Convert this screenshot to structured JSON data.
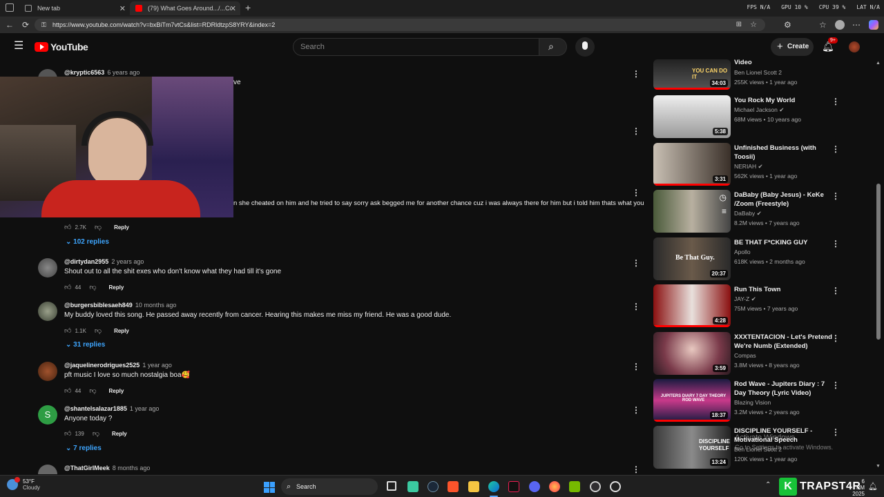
{
  "browser": {
    "tabs": [
      {
        "label": "New tab",
        "active": false
      },
      {
        "label": "(79) What Goes Around.../...Com",
        "active": true
      }
    ],
    "perf": {
      "fps": "FPS N/A",
      "gpu": "GPU 10 %",
      "cpu": "CPU 39 %",
      "lat": "LAT N/A"
    },
    "url": "https://www.youtube.com/watch?v=bxBiTm7vtCs&list=RDRldtzpS8YRY&index=2"
  },
  "header": {
    "logo_text": "YouTube",
    "search_placeholder": "Search",
    "create_label": "Create",
    "notifications_badge": "9+"
  },
  "comments": [
    {
      "handle": "@kryptic6563",
      "age": "6 years ago",
      "text": "ve",
      "likes": "",
      "reply": "",
      "replies": ""
    },
    {
      "handle": "",
      "age": "",
      "text": "n she cheated on him and he tried to say sorry ask begged me for another chance cuz i was always there for him but i told him thats what you",
      "likes": "2.7K",
      "reply": "Reply",
      "replies": "102 replies"
    },
    {
      "handle": "@dirtydan2955",
      "age": "2 years ago",
      "text": "Shout out to all the shit exes who don't know what they had till it's gone",
      "likes": "44",
      "reply": "Reply",
      "replies": ""
    },
    {
      "handle": "@burgersbiblesaeh849",
      "age": "10 months ago",
      "text": "My buddy loved this song. He passed away recently from cancer. Hearing this makes me miss my friend. He was a good dude.",
      "likes": "1.1K",
      "reply": "Reply",
      "replies": "31 replies"
    },
    {
      "handle": "@jaquelinerodrigues2525",
      "age": "1 year ago",
      "text": "pft music I love so much nostalgia boa🥰",
      "likes": "44",
      "reply": "Reply",
      "replies": ""
    },
    {
      "handle": "@shantelsalazar1885",
      "age": "1 year ago",
      "text": "Anyone today ?",
      "likes": "139",
      "reply": "Reply",
      "replies": "7 replies"
    },
    {
      "handle": "@ThatGirlMeek",
      "age": "8 months ago",
      "text": "",
      "likes": "",
      "reply": "",
      "replies": ""
    }
  ],
  "sidebar": [
    {
      "title": "Video",
      "channel": "Ben Lionel Scott 2",
      "meta": "255K views • 1 year ago",
      "duration": "34:03",
      "verified": false
    },
    {
      "title": "You Rock My World",
      "channel": "Michael Jackson",
      "meta": "68M views • 10 years ago",
      "duration": "5:38",
      "verified": true
    },
    {
      "title": "Unfinished Business (with Toosii)",
      "channel": "NERIAH",
      "meta": "562K views • 1 year ago",
      "duration": "3:31",
      "verified": true
    },
    {
      "title": "DaBaby (Baby Jesus) - KeKe /Zoom (Freestyle)",
      "channel": "DaBaby",
      "meta": "8.2M views • 7 years ago",
      "duration": "",
      "verified": true
    },
    {
      "title": "BE THAT F*CKING GUY",
      "channel": "Apollo",
      "meta": "618K views • 2 months ago",
      "duration": "20:37",
      "verified": false
    },
    {
      "title": "Run This Town",
      "channel": "JAY-Z",
      "meta": "75M views • 7 years ago",
      "duration": "4:28",
      "verified": true
    },
    {
      "title": "XXXTENTACION - Let's Pretend We're Numb (Extended)",
      "channel": "Compas",
      "meta": "3.8M views • 8 years ago",
      "duration": "3:59",
      "verified": false
    },
    {
      "title": "Rod Wave - Jupiters Diary : 7 Day Theory (Lyric Video)",
      "channel": "Blazing Vision",
      "meta": "3.2M views • 2 years ago",
      "duration": "18:37",
      "verified": false
    },
    {
      "title": "DISCIPLINE YOURSELF - Motivational Speech",
      "channel": "Ben Lionel Scott 2",
      "meta": "120K views • 1 year ago",
      "duration": "13:24",
      "verified": false
    }
  ],
  "thumb_texts": {
    "youcandoit": "YOU CAN DO IT",
    "bethatguy": "Be That Guy.",
    "jupiters": "JUPITERS DIARY 7 DAY THEORY ROD WAVE",
    "discipline": "DISCIPLINE YOURSELF"
  },
  "watermark": {
    "line1": "Activate Windows",
    "line2": "Go to Settings to activate Windows."
  },
  "taskbar": {
    "weather_temp": "53°F",
    "weather_desc": "Cloudy",
    "search_label": "Search",
    "brand": "TRAPST4R",
    "clock_time": "6 PM",
    "clock_date": "2025"
  },
  "colors": {
    "accent": "#3ea6ff",
    "brand_red": "#ff0000",
    "background": "#0f0f0f"
  }
}
